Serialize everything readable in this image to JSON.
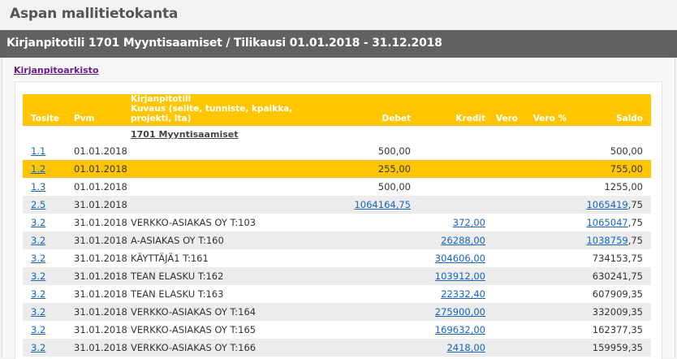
{
  "app": {
    "title": "Aspan mallitietokanta"
  },
  "page": {
    "title": "Kirjanpitotili 1701 Myyntisaamiset / Tilikausi 01.01.2018 - 31.12.2018",
    "archive_link": "Kirjanpitoarkisto"
  },
  "table": {
    "headers": {
      "tosite": "Tosite",
      "pvm": "Pvm",
      "desc_line1": "Kirjanpitotili",
      "desc_line2": "Kuvaus (selite, tunniste, kpaikka, projekti, lta)",
      "debet": "Debet",
      "kredit": "Kredit",
      "vero": "Vero",
      "vero_pct": "Vero %",
      "saldo": "Saldo"
    },
    "account_heading": "1701 Myyntisaamiset",
    "rows": [
      {
        "tosite": "1.1",
        "pvm": "01.01.2018",
        "kuvaus": "",
        "debet": "500,00",
        "kredit": "",
        "vero": "",
        "vero_pct": "",
        "saldo_link": "",
        "saldo_rest": "500,00"
      },
      {
        "tosite": "1.2",
        "pvm": "01.01.2018",
        "kuvaus": "",
        "debet": "255,00",
        "kredit": "",
        "vero": "",
        "vero_pct": "",
        "saldo_link": "",
        "saldo_rest": "755,00"
      },
      {
        "tosite": "1.3",
        "pvm": "01.01.2018",
        "kuvaus": "",
        "debet": "500,00",
        "kredit": "",
        "vero": "",
        "vero_pct": "",
        "saldo_link": "",
        "saldo_rest": "1255,00"
      },
      {
        "tosite": "2.5",
        "pvm": "31.01.2018",
        "kuvaus": "",
        "debet": "1064164,75",
        "kredit": "",
        "vero": "",
        "vero_pct": "",
        "saldo_link": "1065419",
        "saldo_rest": ",75"
      },
      {
        "tosite": "3.2",
        "pvm": "31.01.2018",
        "kuvaus": "VERKKO-ASIAKAS OY T:103",
        "debet": "",
        "kredit": "372,00",
        "vero": "",
        "vero_pct": "",
        "saldo_link": "1065047",
        "saldo_rest": ",75"
      },
      {
        "tosite": "3.2",
        "pvm": "31.01.2018",
        "kuvaus": "A-ASIAKAS OY T:160",
        "debet": "",
        "kredit": "26288,00",
        "vero": "",
        "vero_pct": "",
        "saldo_link": "1038759",
        "saldo_rest": ",75"
      },
      {
        "tosite": "3.2",
        "pvm": "31.01.2018",
        "kuvaus": "KÄYTTÄJÄ1 T:161",
        "debet": "",
        "kredit": "304606,00",
        "vero": "",
        "vero_pct": "",
        "saldo_link": "",
        "saldo_rest": "734153,75"
      },
      {
        "tosite": "3.2",
        "pvm": "31.01.2018",
        "kuvaus": "TEAN ELASKU T:162",
        "debet": "",
        "kredit": "103912,00",
        "vero": "",
        "vero_pct": "",
        "saldo_link": "",
        "saldo_rest": "630241,75"
      },
      {
        "tosite": "3.2",
        "pvm": "31.01.2018",
        "kuvaus": "TEAN ELASKU T:163",
        "debet": "",
        "kredit": "22332,40",
        "vero": "",
        "vero_pct": "",
        "saldo_link": "",
        "saldo_rest": "607909,35"
      },
      {
        "tosite": "3.2",
        "pvm": "31.01.2018",
        "kuvaus": "VERKKO-ASIAKAS OY T:164",
        "debet": "",
        "kredit": "275900,00",
        "vero": "",
        "vero_pct": "",
        "saldo_link": "",
        "saldo_rest": "332009,35"
      },
      {
        "tosite": "3.2",
        "pvm": "31.01.2018",
        "kuvaus": "VERKKO-ASIAKAS OY T:165",
        "debet": "",
        "kredit": "169632,00",
        "vero": "",
        "vero_pct": "",
        "saldo_link": "",
        "saldo_rest": "162377,35"
      },
      {
        "tosite": "3.2",
        "pvm": "31.01.2018",
        "kuvaus": "VERKKO-ASIAKAS OY T:166",
        "debet": "",
        "kredit": "2418,00",
        "vero": "",
        "vero_pct": "",
        "saldo_link": "",
        "saldo_rest": "159959,35"
      }
    ],
    "selected_row_index": 1
  },
  "colors": {
    "header_bar": "#616161",
    "table_header": "#ffc600",
    "selected_row": "#ffc600",
    "link": "#1565c0",
    "archive_link": "#6a1b8a"
  }
}
